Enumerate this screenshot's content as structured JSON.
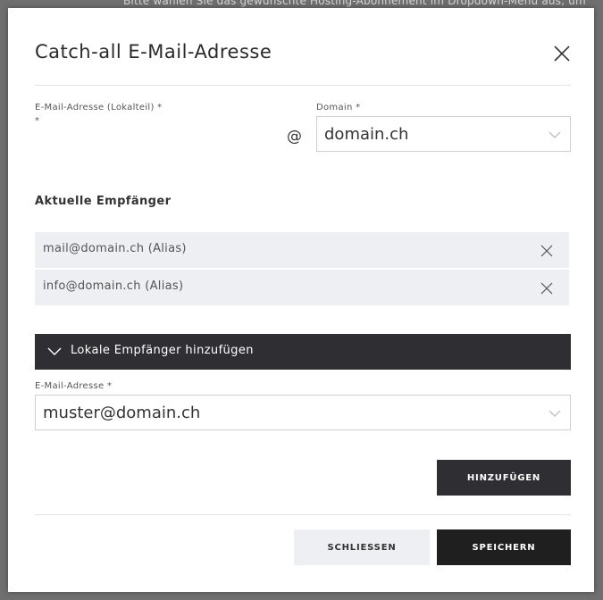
{
  "background": {
    "text": "Bitte wählen Sie das gewünschte Hosting-Abonnement im Dropdown-Menü aus, um"
  },
  "modal": {
    "title": "Catch-all E-Mail-Adresse",
    "close_icon": "close-icon"
  },
  "form": {
    "local_part_label": "E-Mail-Adresse (Lokalteil) *",
    "local_part_asterisk": "*",
    "at_sign": "@",
    "domain_label": "Domain *",
    "domain_value": "domain.ch"
  },
  "recipients": {
    "title": "Aktuelle Empfänger",
    "items": [
      {
        "label": "mail@domain.ch (Alias)"
      },
      {
        "label": "info@domain.ch (Alias)"
      }
    ]
  },
  "add_local": {
    "accordion_label": "Lokale Empfänger hinzufügen",
    "email_label": "E-Mail-Adresse *",
    "email_value": "muster@domain.ch",
    "add_button": "HINZUFÜGEN"
  },
  "footer": {
    "close_button": "SCHLIESSEN",
    "save_button": "SPEICHERN"
  },
  "colors": {
    "dark_button": "#2f2f33",
    "primary_button": "#1f1f1f",
    "light_button": "#eeeff2",
    "recipient_bg": "#eeeff2"
  }
}
